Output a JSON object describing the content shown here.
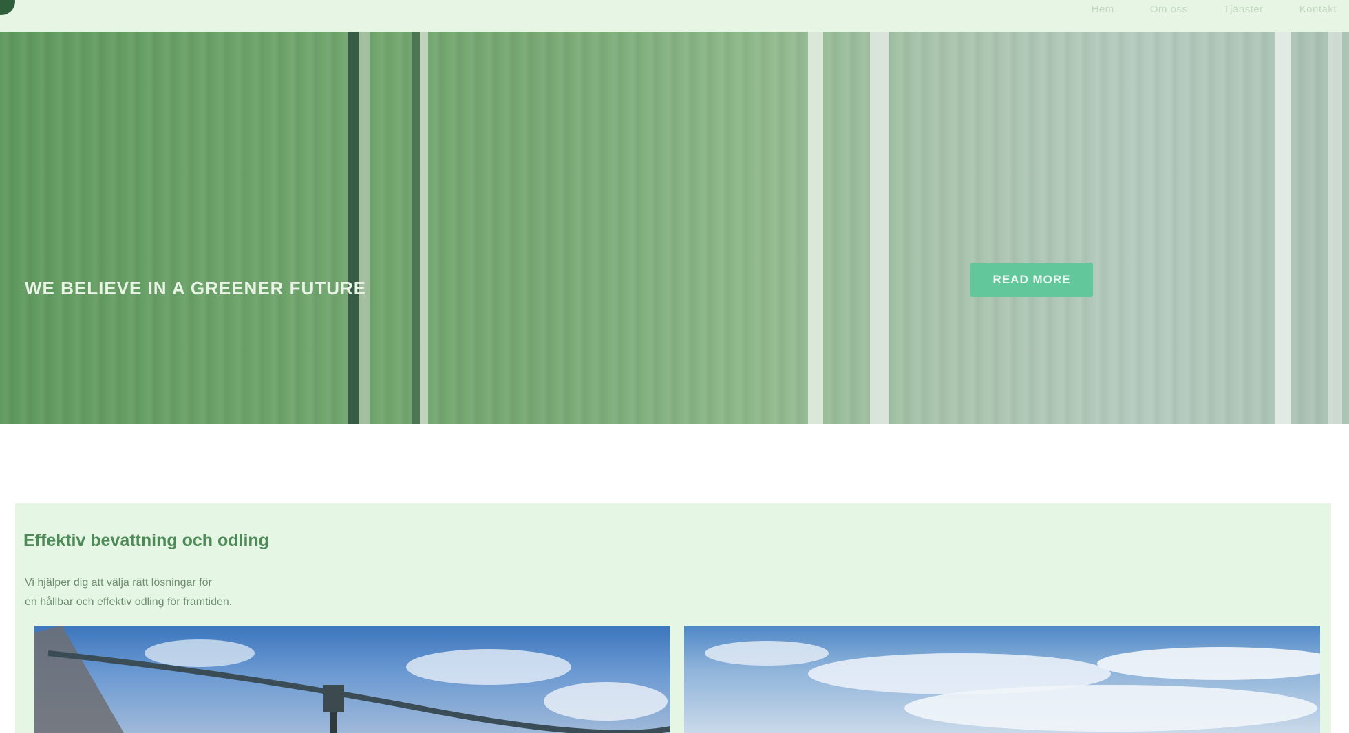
{
  "nav": {
    "items": [
      "Hem",
      "Om oss",
      "Tjänster",
      "Kontakt"
    ]
  },
  "hero": {
    "title": "WE BELIEVE IN A GREENER FUTURE",
    "cta_label": "READ MORE"
  },
  "section": {
    "title": "Effektiv bevattning och odling",
    "description_line1": "Vi hjälper dig att välja rätt lösningar för",
    "description_line2": "en hållbar och effektiv odling för framtiden."
  },
  "colors": {
    "topbar": "#e6f5e4",
    "hero_green": "#6ea46b",
    "cta": "#63c79c",
    "section_bg": "#e6f6e5",
    "section_title": "#4e8a57"
  }
}
